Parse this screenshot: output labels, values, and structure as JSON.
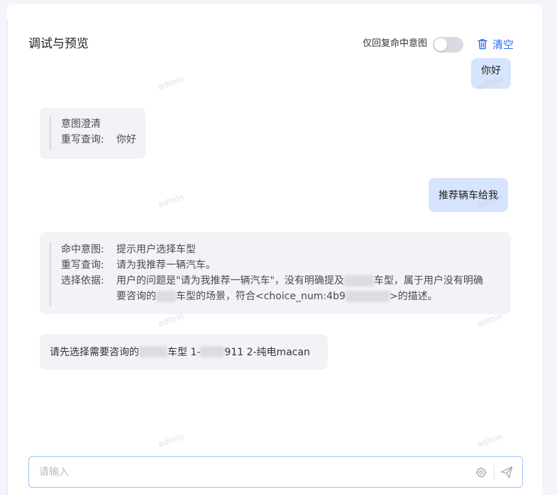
{
  "header": {
    "title": "调试与预览",
    "toggle_label": "仅回复命中意图",
    "toggle_on": false,
    "clear_label": "清空"
  },
  "messages": {
    "user1": "你好",
    "bot1": {
      "title": "意图澄清",
      "rewrite_key": "重写查询:",
      "rewrite_value": "你好"
    },
    "user2": "推荐辆车给我",
    "bot2": {
      "intent_key": "命中意图:",
      "intent_value": "提示用户选择车型",
      "rewrite_key": "重写查询:",
      "rewrite_value": "请为我推荐一辆汽车。",
      "basis_key": "选择依据:",
      "basis_line1_a": "用户的问题是\"请为我推荐一辆汽车\"，没有明确提及",
      "basis_line1_b": "车型，属于用户没有明确",
      "basis_line2_a": "要咨询的",
      "basis_line2_b": "车型的场景，符合<choice_num:4b9",
      "basis_line2_c": ">的描述。"
    },
    "bot3": {
      "part_a": "请先选择需要咨询的",
      "part_b": "车型 1-",
      "part_c": "911 2-纯电macan"
    }
  },
  "watermark": "admin",
  "input": {
    "placeholder": "请输入",
    "value": ""
  },
  "colors": {
    "accent": "#2a6ef0",
    "user_bubble": "#d6e4fd",
    "bot_bubble": "#f2f3f7",
    "input_border": "#9ec3f5"
  }
}
